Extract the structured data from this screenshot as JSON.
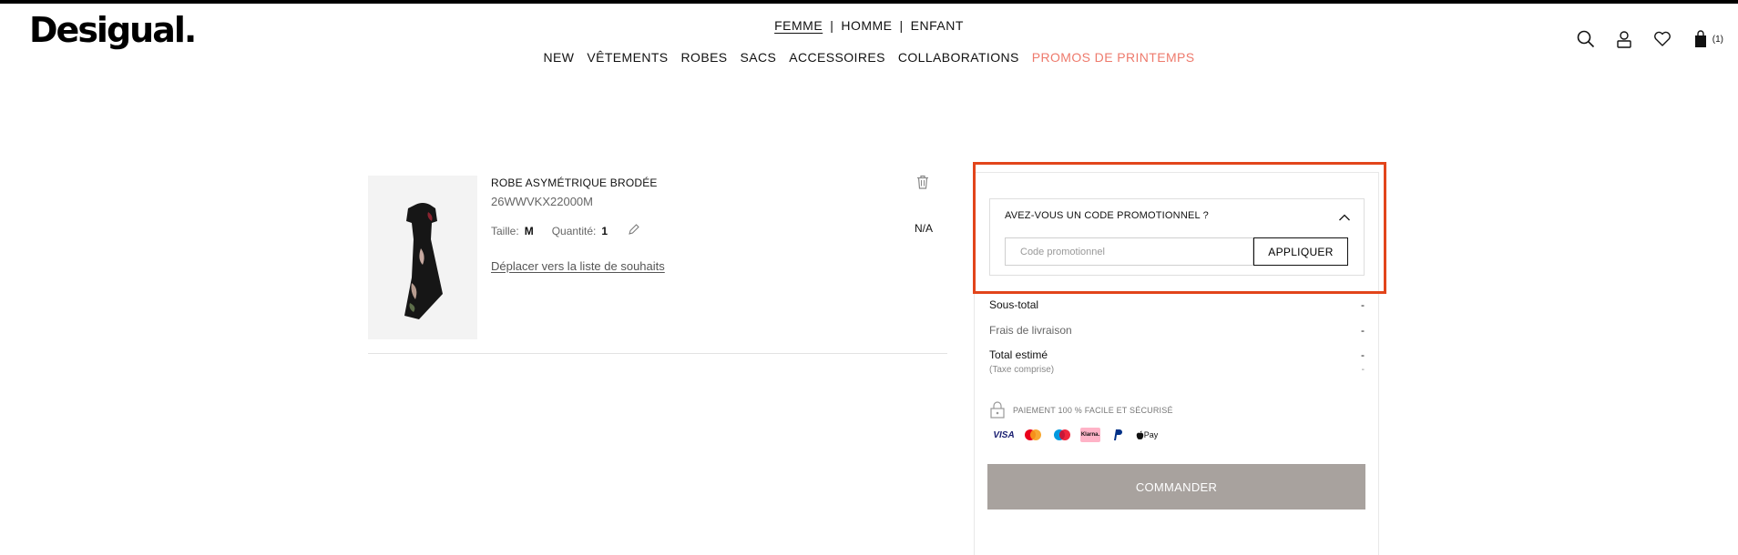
{
  "brand": {
    "logo": "Desigual."
  },
  "gender_nav": [
    "FEMME",
    "HOMME",
    "ENFANT"
  ],
  "main_nav": [
    {
      "label": "NEW"
    },
    {
      "label": "VÊTEMENTS"
    },
    {
      "label": "ROBES"
    },
    {
      "label": "SACS"
    },
    {
      "label": "ACCESSOIRES"
    },
    {
      "label": "COLLABORATIONS"
    },
    {
      "label": "PROMOS DE PRINTEMPS",
      "color": "#ee7a6c"
    }
  ],
  "header_icons": [
    "search-icon",
    "account-icon",
    "heart-icon",
    "bag-icon"
  ],
  "cart": {
    "count": "(1)"
  },
  "product": {
    "name": "ROBE ASYMÉTRIQUE BRODÉE",
    "ref": "26WWVKX22000M",
    "size_label": "Taille:",
    "size_value": "M",
    "qty_label": "Quantité:",
    "qty_value": "1",
    "price": "N/A",
    "wishlist_link": "Déplacer vers la liste de souhaits"
  },
  "promo": {
    "title": "AVEZ-VOUS UN CODE PROMOTIONNEL ?",
    "placeholder": "Code promotionnel",
    "apply_label": "APPLIQUER"
  },
  "summary": {
    "subtotal_label": "Sous-total",
    "subtotal_value": "-",
    "shipping_label": "Frais de livraison",
    "shipping_value": "-",
    "total_label": "Total estimé",
    "total_value": "-",
    "tax_label": "(Taxe comprise)",
    "tax_value": "-"
  },
  "security": {
    "text": "PAIEMENT 100 %  FACILE ET SÉCURISÉ"
  },
  "payment_methods": [
    "VISA",
    "Mastercard",
    "Maestro",
    "Klarna.",
    "PayPal",
    "Pay"
  ],
  "checkout": {
    "label": "COMMANDER"
  },
  "colors": {
    "accent_promo": "#ee7a6c",
    "checkout_bg": "#a8a29e",
    "highlight": "#e2451b"
  }
}
